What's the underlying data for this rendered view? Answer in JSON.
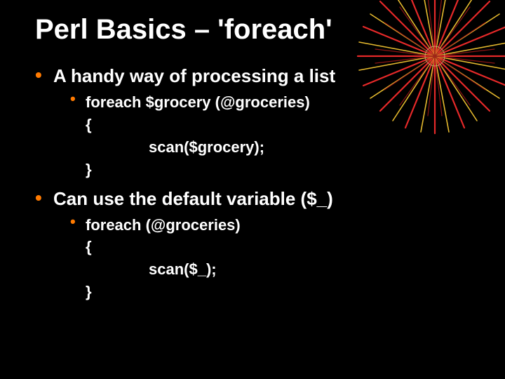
{
  "title": "Perl Basics – 'foreach'",
  "bullets": {
    "b1": "A handy way of processing a list",
    "b2": "Can use the default variable ($_)"
  },
  "code1": {
    "l1": "foreach $grocery (@groceries)",
    "l2": "{",
    "l3": "scan($grocery);",
    "l4": "}"
  },
  "code2": {
    "l1": "foreach (@groceries)",
    "l2": "{",
    "l3": "scan($_);",
    "l4": "}"
  }
}
